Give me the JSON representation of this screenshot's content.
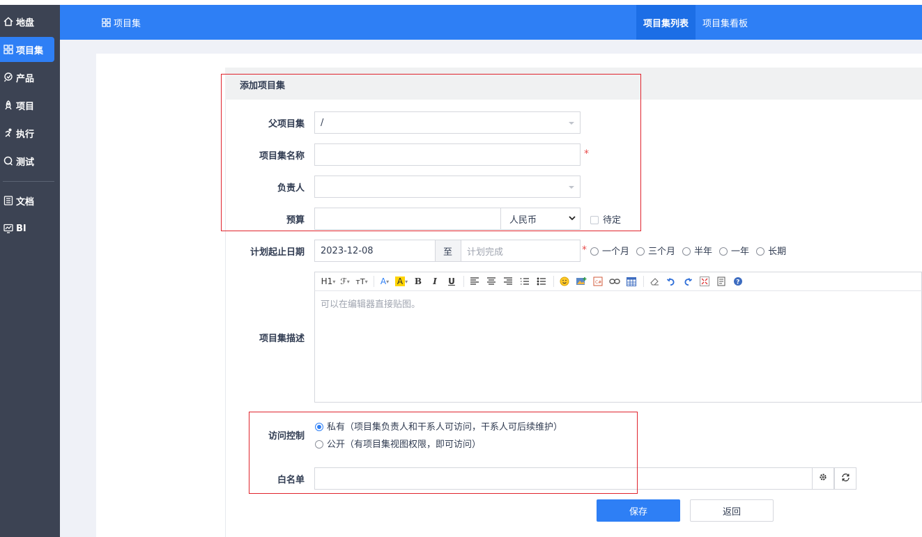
{
  "sidebar": {
    "items": [
      {
        "label": "地盘",
        "icon": "home-icon"
      },
      {
        "label": "项目集",
        "icon": "grid-icon"
      },
      {
        "label": "产品",
        "icon": "product-icon"
      },
      {
        "label": "项目",
        "icon": "project-icon"
      },
      {
        "label": "执行",
        "icon": "run-icon"
      },
      {
        "label": "测试",
        "icon": "test-icon"
      },
      {
        "label": "文档",
        "icon": "doc-icon"
      },
      {
        "label": "BI",
        "icon": "bi-icon"
      }
    ],
    "active_index": 1
  },
  "header": {
    "title": "项目集",
    "tabs": [
      "项目集列表",
      "项目集看板"
    ],
    "active_tab": 0,
    "accent": "#2e7ff5"
  },
  "form": {
    "title": "添加项目集",
    "parent": {
      "label": "父项目集",
      "value": "/"
    },
    "name": {
      "label": "项目集名称",
      "value": "",
      "required": "*"
    },
    "owner": {
      "label": "负责人",
      "value": ""
    },
    "budget": {
      "label": "预算",
      "value": "",
      "currency": "人民币",
      "tbd_label": "待定"
    },
    "dates": {
      "label": "计划起止日期",
      "begin": "2023-12-08",
      "separator": "至",
      "end_placeholder": "计划完成",
      "required": "*",
      "options": [
        "一个月",
        "三个月",
        "半年",
        "一年",
        "长期"
      ]
    },
    "description": {
      "label": "项目集描述",
      "placeholder": "可以在编辑器直接贴图。",
      "toolbar": [
        "H1",
        "ℱ",
        "тT",
        "A",
        "A",
        "B",
        "I",
        "U"
      ]
    },
    "access": {
      "label": "访问控制",
      "options": [
        {
          "text": "私有（项目集负责人和干系人可访问，干系人可后续维护）",
          "selected": true
        },
        {
          "text": "公开（有项目集视图权限，即可访问）",
          "selected": false
        }
      ]
    },
    "whitelist": {
      "label": "白名单",
      "value": ""
    },
    "save_label": "保存",
    "back_label": "返回"
  }
}
